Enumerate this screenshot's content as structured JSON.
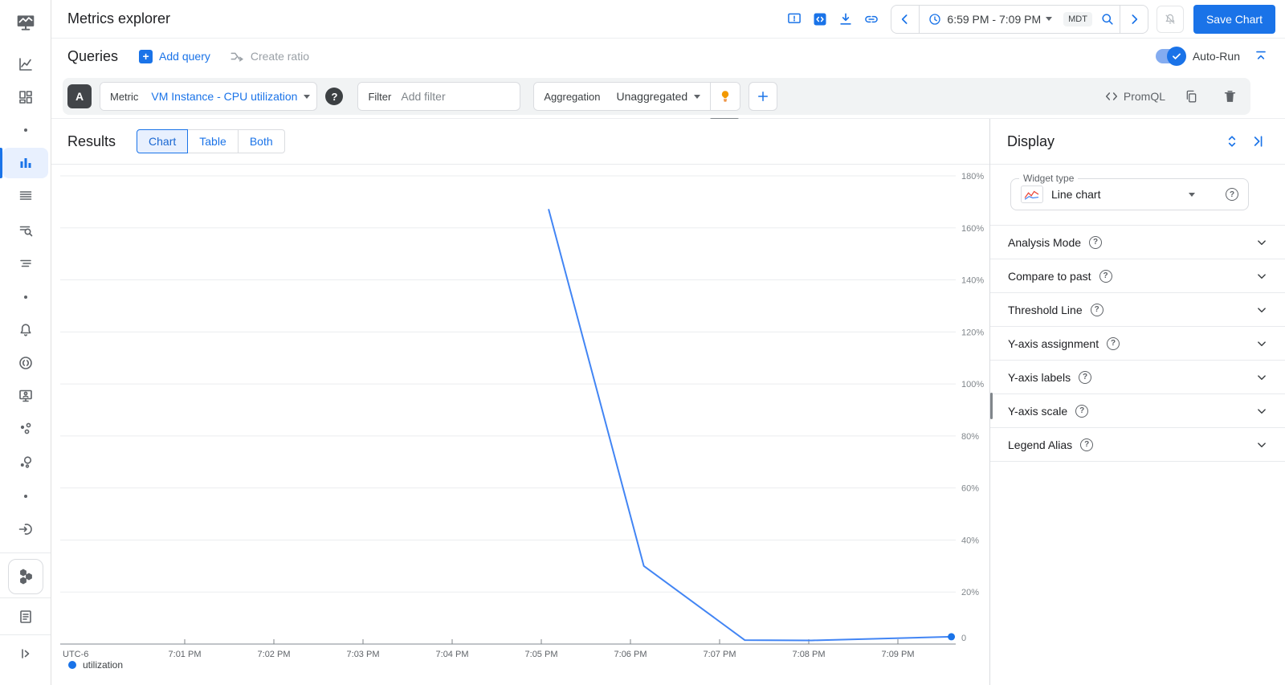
{
  "header": {
    "title": "Metrics explorer",
    "time_range_value": "6:59 PM - 7:09 PM",
    "timezone_chip": "MDT",
    "save_chart_label": "Save Chart"
  },
  "queries_bar": {
    "heading": "Queries",
    "add_query_label": "Add query",
    "create_ratio_label": "Create ratio",
    "auto_run_label": "Auto-Run"
  },
  "query_row": {
    "query_letter": "A",
    "metric_label": "Metric",
    "metric_value": "VM Instance - CPU utilization",
    "filter_label": "Filter",
    "filter_placeholder": "Add filter",
    "aggregation_label": "Aggregation",
    "aggregation_value": "Unaggregated",
    "promql_label": "PromQL"
  },
  "results_bar": {
    "heading": "Results",
    "tabs": [
      {
        "label": "Chart",
        "active": true
      },
      {
        "label": "Table",
        "active": false
      },
      {
        "label": "Both",
        "active": false
      }
    ]
  },
  "chart_data": {
    "type": "line",
    "title": "",
    "timezone_label": "UTC-6",
    "x_ticks": [
      "7:01 PM",
      "7:02 PM",
      "7:03 PM",
      "7:04 PM",
      "7:05 PM",
      "7:06 PM",
      "7:07 PM",
      "7:08 PM",
      "7:09 PM"
    ],
    "y_ticks": [
      "180%",
      "160%",
      "140%",
      "120%",
      "100%",
      "80%",
      "60%",
      "40%",
      "20%",
      "0"
    ],
    "ylim": [
      0,
      190
    ],
    "grid": "horizontal",
    "legend_position": "bottom-left",
    "series": [
      {
        "name": "utilization",
        "color": "#4285f4",
        "points": [
          {
            "time": "7:05:05 PM",
            "value": 167
          },
          {
            "time": "7:06:09 PM",
            "value": 30
          },
          {
            "time": "7:07:17 PM",
            "value": 1.5
          },
          {
            "time": "7:08:02 PM",
            "value": 1.4
          },
          {
            "time": "7:09:36 PM",
            "value": 2.8
          }
        ]
      }
    ]
  },
  "display_panel": {
    "heading": "Display",
    "widget_type": {
      "label": "Widget type",
      "value": "Line chart"
    },
    "sections": [
      "Analysis Mode",
      "Compare to past",
      "Threshold Line",
      "Y-axis assignment",
      "Y-axis labels",
      "Y-axis scale",
      "Legend Alias"
    ]
  },
  "colors": {
    "accent": "#1a73e8",
    "chart_line": "#4285f4",
    "selected_tab_bg": "#e8f0fe",
    "toolbar_bg": "#f1f3f4",
    "warning_bulb": "#f29900",
    "query_badge_bg": "#424549"
  }
}
